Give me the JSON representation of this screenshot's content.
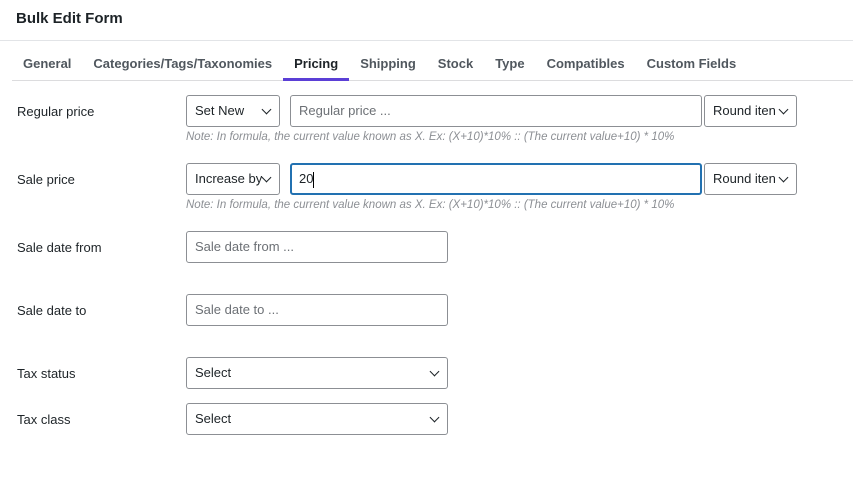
{
  "title": "Bulk Edit Form",
  "tabs": [
    "General",
    "Categories/Tags/Taxonomies",
    "Pricing",
    "Shipping",
    "Stock",
    "Type",
    "Compatibles",
    "Custom Fields"
  ],
  "active_tab": "Pricing",
  "regular_price": {
    "label": "Regular price",
    "mode": "Set New",
    "placeholder": "Regular price ...",
    "round": "Round iten"
  },
  "sale_price": {
    "label": "Sale price",
    "mode": "Increase by",
    "value": "20",
    "round": "Round iten"
  },
  "note": "Note: In formula, the current value known as X. Ex: (X+10)*10% :: (The current value+10) * 10%",
  "sale_date_from": {
    "label": "Sale date from",
    "placeholder": "Sale date from ..."
  },
  "sale_date_to": {
    "label": "Sale date to",
    "placeholder": "Sale date to ..."
  },
  "tax_status": {
    "label": "Tax status",
    "value": "Select"
  },
  "tax_class": {
    "label": "Tax class",
    "value": "Select"
  }
}
